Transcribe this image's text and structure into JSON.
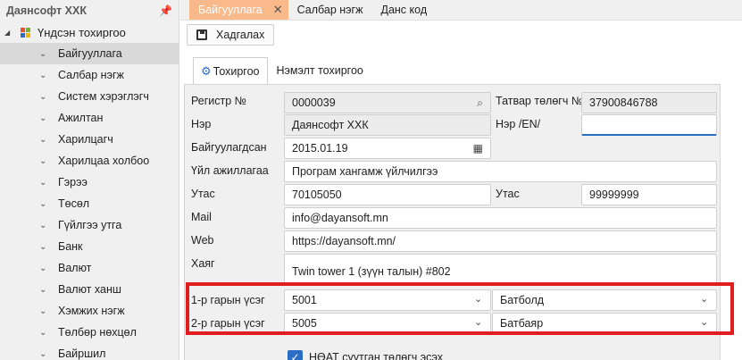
{
  "sidebar": {
    "title": "Даянсофт ХХК",
    "root_label": "Үндсэн тохиргоо",
    "items": [
      {
        "label": "Байгууллага"
      },
      {
        "label": "Салбар нэгж"
      },
      {
        "label": "Систем хэрэглэгч"
      },
      {
        "label": "Ажилтан"
      },
      {
        "label": "Харилцагч"
      },
      {
        "label": "Харилцаа холбоо"
      },
      {
        "label": "Гэрээ"
      },
      {
        "label": "Төсөл"
      },
      {
        "label": "Гүйлгээ утга"
      },
      {
        "label": "Банк"
      },
      {
        "label": "Валют"
      },
      {
        "label": "Валют ханш"
      },
      {
        "label": "Хэмжих нэгж"
      },
      {
        "label": "Төлбөр нөхцөл"
      },
      {
        "label": "Байршил"
      }
    ]
  },
  "tabs": [
    {
      "label": "Байгууллага"
    },
    {
      "label": "Салбар нэгж"
    },
    {
      "label": "Данс код"
    }
  ],
  "toolbar": {
    "save_label": "Хадгалах"
  },
  "content_tabs": [
    {
      "label": "Тохиргоо"
    },
    {
      "label": "Нэмэлт тохиргоо"
    }
  ],
  "form": {
    "register_label": "Регистр №",
    "register_value": "0000039",
    "taxpayer_label": "Татвар төлөгч №",
    "taxpayer_value": "37900846788",
    "name_label": "Нэр",
    "name_value": "Даянсофт ХХК",
    "name_en_label": "Нэр /EN/",
    "name_en_value": "",
    "founded_label": "Байгуулагдсан",
    "founded_value": "2015.01.19",
    "activity_label": "Үйл ажиллагаа",
    "activity_value": "Програм хангамж үйлчилгээ",
    "phone_label": "Утас",
    "phone_value": "70105050",
    "phone2_label": "Утас",
    "phone2_value": "99999999",
    "mail_label": "Mail",
    "mail_value": "info@dayansoft.mn",
    "web_label": "Web",
    "web_value": "https://dayansoft.mn/",
    "address_label": "Хаяг",
    "address_value": "Twin tower 1 (зүүн талын) #802",
    "sign1_label": "1-р гарын үсэг",
    "sign1_code": "5001",
    "sign1_name": "Батболд",
    "sign2_label": "2-р гарын үсэг",
    "sign2_code": "5005",
    "sign2_name": "Батбаяр",
    "vat_label": "НӨАТ суутган төлөгч эсэх"
  },
  "colors": {
    "active_tab": "#f9b98a",
    "accent": "#2b6cc4",
    "highlight": "#e01e1e"
  }
}
